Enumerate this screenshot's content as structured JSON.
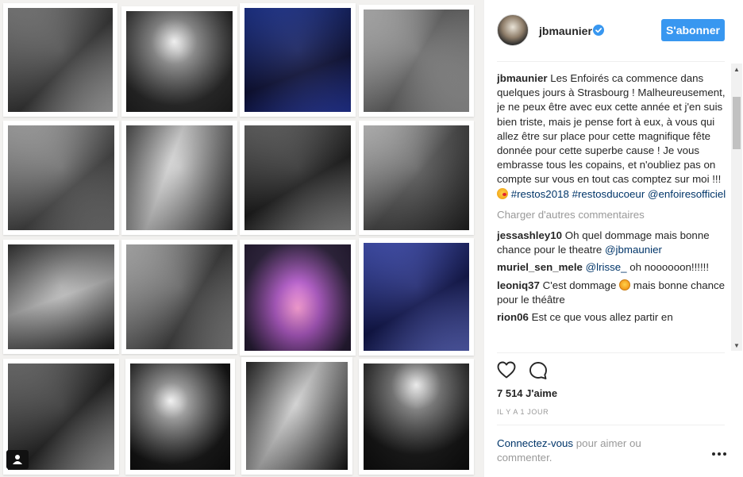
{
  "post": {
    "username": "jbmaunier",
    "follow_label": "S'abonner",
    "caption_text": "Les Enfoirés ca commence dans quelques jours à Strasbourg ! Malheureusement, je ne peux être avec eux cette année et j'en suis bien triste, mais je pense fort à eux, à vous qui allez être sur place pour cette magnifique fête donnée pour cette superbe cause ! Je vous embrasse tous les copains, et n'oubliez pas on compte sur vous en tout cas comptez sur moi !!! ",
    "hashtags": [
      "#restos2018",
      "#restosducoeur"
    ],
    "mention": "@enfoiresofficiel",
    "load_more": "Charger d'autres commentaires",
    "likes": "7 514 J'aime",
    "time": "IL Y A 1 JOUR",
    "login_link": "Connectez-vous",
    "login_rest": " pour aimer ou commenter."
  },
  "comments": [
    {
      "user": "jessashley10",
      "text": " Oh quel dommage mais bonne chance pour le theatre ",
      "mention": "@jbmaunier"
    },
    {
      "user": "muriel_sen_mele",
      "text": "",
      "mention": "@lrisse_",
      "after": " oh noooooon!!!!!!"
    },
    {
      "user": "leoniq37",
      "text": " C'est dommage ",
      "after": " mais bonne chance pour le théâtre"
    },
    {
      "user": "rion06",
      "text": " Est ce que vous allez partir en"
    }
  ],
  "colors": {
    "accent": "#3897f0",
    "link": "#003569",
    "muted": "#999999",
    "verified": "#3897f0"
  },
  "icons": [
    "verified-badge-icon",
    "heart-icon",
    "comment-icon",
    "more-options-icon",
    "user-tag-icon",
    "scroll-up-icon",
    "scroll-down-icon"
  ]
}
